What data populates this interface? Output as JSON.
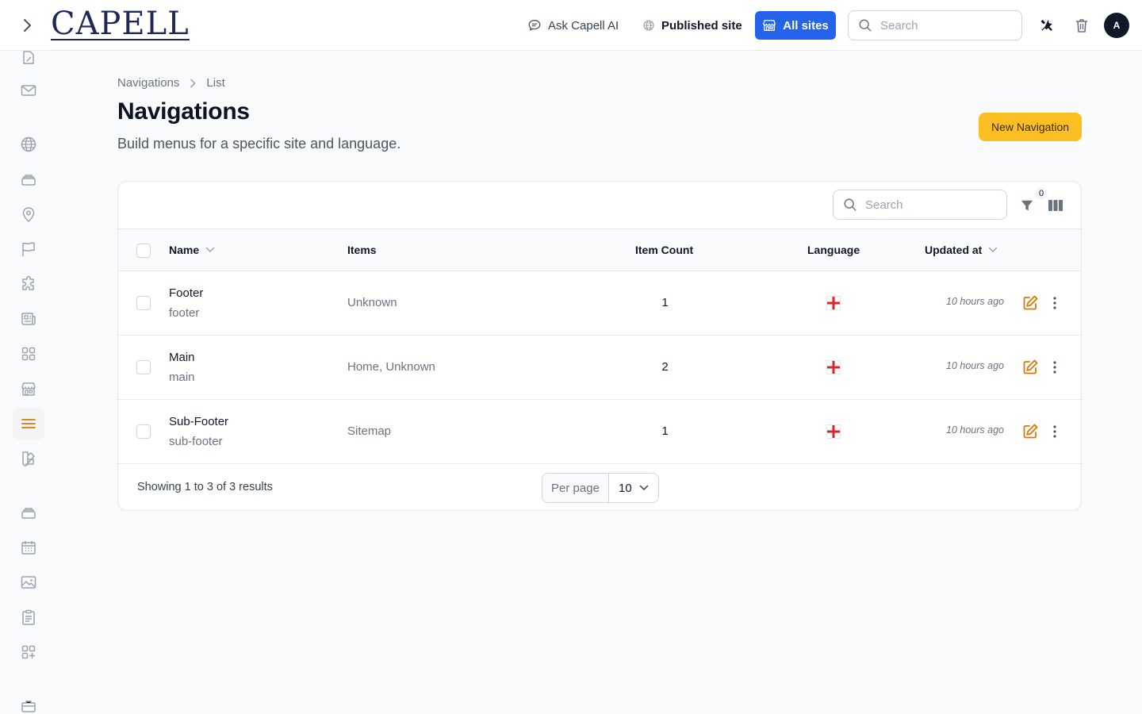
{
  "topbar": {
    "logo": "CAPELL",
    "ask_label": "Ask Capell AI",
    "published_label": "Published site",
    "all_sites_label": "All sites",
    "search_placeholder": "Search",
    "avatar_initial": "A"
  },
  "sidebar": {
    "items": [
      {
        "icon": "pages-icon"
      },
      {
        "icon": "mail-icon"
      },
      {
        "icon": "globe-icon"
      },
      {
        "icon": "archive-icon"
      },
      {
        "icon": "map-pin-icon"
      },
      {
        "icon": "flag-icon"
      },
      {
        "icon": "puzzle-icon"
      },
      {
        "icon": "newspaper-icon"
      },
      {
        "icon": "grid-icon"
      },
      {
        "icon": "storefront-icon"
      },
      {
        "icon": "menu-icon",
        "active": true
      },
      {
        "icon": "swatch-icon"
      },
      {
        "icon": "archive-icon"
      },
      {
        "icon": "calendar-icon"
      },
      {
        "icon": "image-icon"
      },
      {
        "icon": "clipboard-icon"
      },
      {
        "icon": "grid-plus-icon"
      },
      {
        "icon": "briefcase-icon"
      }
    ]
  },
  "breadcrumb": [
    "Navigations",
    "List"
  ],
  "page": {
    "title": "Navigations",
    "subtitle": "Build menus for a specific site and language.",
    "new_button": "New Navigation"
  },
  "table": {
    "search_placeholder": "Search",
    "filter_count": "0",
    "columns": [
      "Name",
      "Items",
      "Item Count",
      "Language",
      "Updated at"
    ],
    "rows": [
      {
        "name": "Footer",
        "slug": "footer",
        "items": "Unknown",
        "count": "1",
        "updated": "10 hours ago"
      },
      {
        "name": "Main",
        "slug": "main",
        "items": "Home, Unknown",
        "count": "2",
        "updated": "10 hours ago"
      },
      {
        "name": "Sub-Footer",
        "slug": "sub-footer",
        "items": "Sitemap",
        "count": "1",
        "updated": "10 hours ago"
      }
    ],
    "showing": "Showing 1 to 3 of 3 results",
    "per_page_label": "Per page",
    "per_page_value": "10"
  },
  "colors": {
    "accent": "#2563eb",
    "new_button": "#fbbf24",
    "edit_icon": "#d97706"
  }
}
